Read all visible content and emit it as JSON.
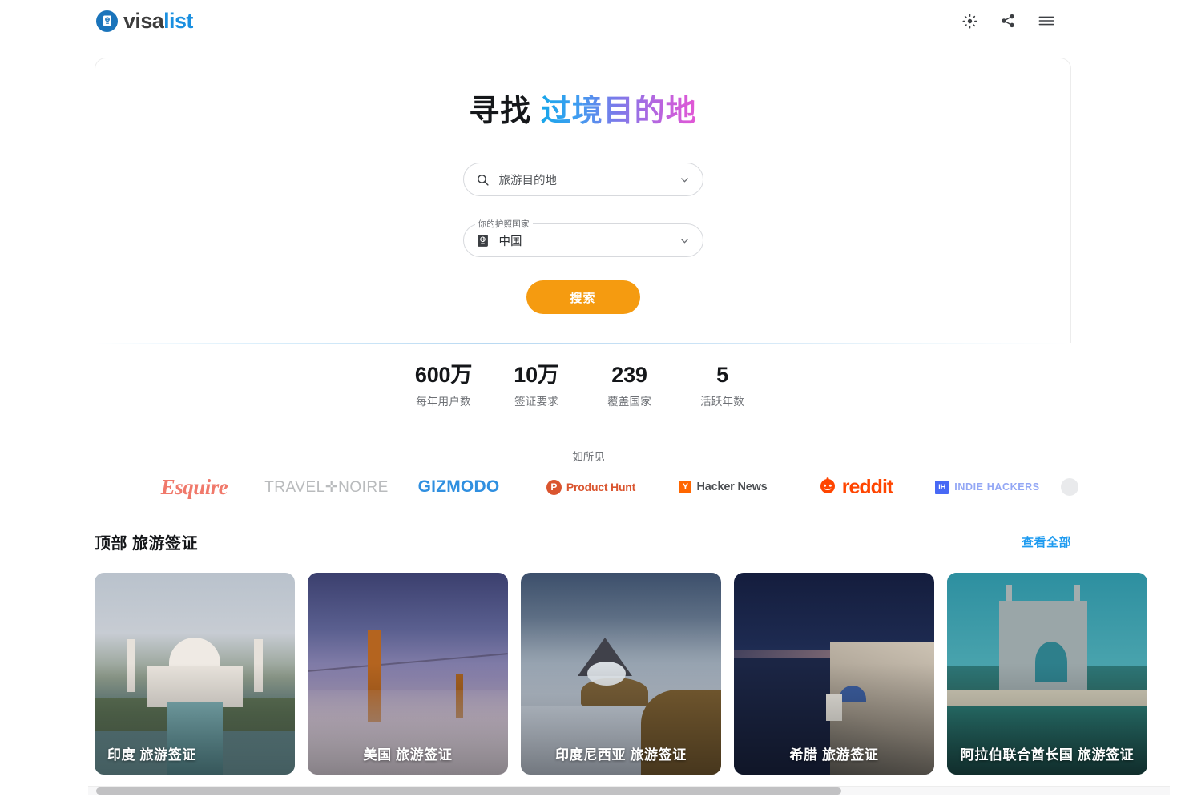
{
  "header": {
    "logo": {
      "part1": "visa",
      "part2": "list",
      "icon": "passport-icon",
      "brand_blue": "#1a8fe0"
    },
    "actions": [
      {
        "name": "theme-toggle",
        "icon": "sun-icon"
      },
      {
        "name": "share",
        "icon": "share-icon"
      },
      {
        "name": "menu",
        "icon": "hamburger-menu-icon"
      }
    ]
  },
  "hero": {
    "title_plain": "寻找",
    "title_gradient": "过境目的地",
    "destination": {
      "placeholder": "旅游目的地",
      "icon": "search-icon",
      "chevron": "chevron-down-icon"
    },
    "passport": {
      "label": "你的护照国家",
      "value": "中国",
      "icon": "passport-icon",
      "chevron": "chevron-down-icon"
    },
    "search_button": "搜索",
    "accent_orange": "#f59b10"
  },
  "stats": [
    {
      "value": "600万",
      "label": "每年用户数"
    },
    {
      "value": "10万",
      "label": "签证要求"
    },
    {
      "value": "239",
      "label": "覆盖国家"
    },
    {
      "value": "5",
      "label": "活跃年数"
    }
  ],
  "press": {
    "heading": "如所见",
    "logos": [
      {
        "name": "esquire",
        "text": "Esquire",
        "color": "#f0796b"
      },
      {
        "name": "travel-noire",
        "text": "TRAVEL✛NOIRE",
        "color": "#b9bbbd"
      },
      {
        "name": "gizmodo",
        "text": "GIZMODO",
        "color": "#2f8fe0"
      },
      {
        "name": "product-hunt",
        "text": "Product Hunt",
        "badge": "P",
        "color": "#da552f"
      },
      {
        "name": "hacker-news",
        "text": "Hacker News",
        "badge": "Y",
        "color": "#ff6600"
      },
      {
        "name": "reddit",
        "text": "reddit",
        "color": "#ff4500"
      },
      {
        "name": "indie-hackers",
        "text": "INDIE HACKERS",
        "badge": "IH",
        "color": "#4869f5"
      }
    ]
  },
  "section": {
    "title": "顶部 旅游签证",
    "view_all": "查看全部",
    "link_color": "#1e9bf0"
  },
  "cards": [
    {
      "name": "card-india",
      "label": "印度 旅游签证",
      "image": "taj-mahal-photo",
      "align": "left"
    },
    {
      "name": "card-usa",
      "label": "美国 旅游签证",
      "image": "golden-gate-bridge-photo",
      "align": "center"
    },
    {
      "name": "card-indonesia",
      "label": "印度尼西亚 旅游签证",
      "image": "mount-bromo-photo",
      "align": "center"
    },
    {
      "name": "card-greece",
      "label": "希腊 旅游签证",
      "image": "santorini-photo",
      "align": "center"
    },
    {
      "name": "card-uae",
      "label": "阿拉伯联合酋长国 旅游签证",
      "image": "atlantis-dubai-photo",
      "align": "center"
    }
  ]
}
